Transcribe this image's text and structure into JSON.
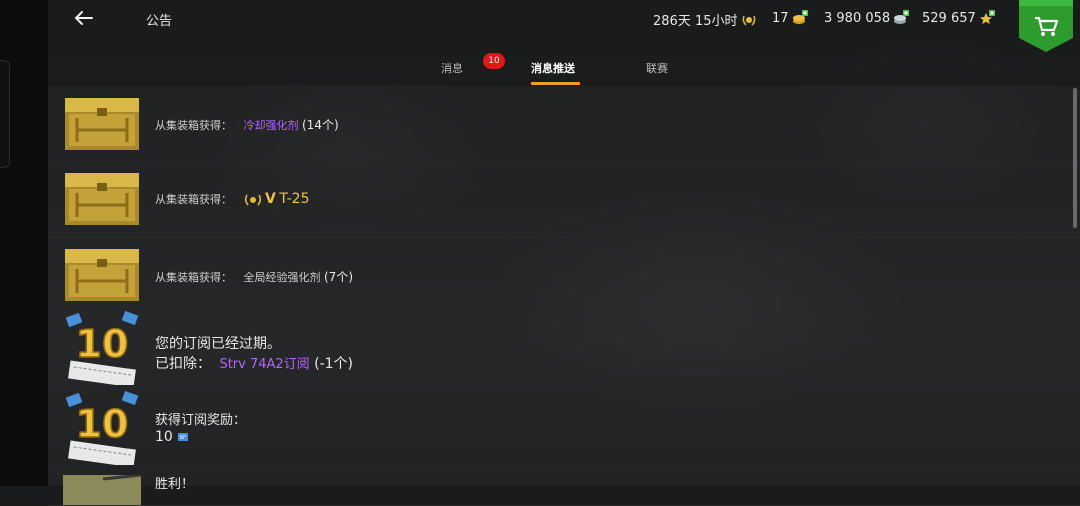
{
  "header": {
    "title": "公告",
    "premium_time": "286天 15小时",
    "gold": "17",
    "credits": "3 980 058",
    "free_xp": "529 657"
  },
  "tabs": [
    {
      "label": "消息",
      "badge": "10"
    },
    {
      "label": "消息推送",
      "active": true
    },
    {
      "label": "联赛"
    }
  ],
  "messages": [
    {
      "prefix": "从集装箱获得：",
      "item": "冷却强化剂",
      "qty": "(14个)",
      "icon": "gold-container-icon"
    },
    {
      "prefix": "从集装箱获得：",
      "tier": "V",
      "item": "T-25",
      "icon": "gold-container-icon"
    },
    {
      "prefix": "从集装箱获得：",
      "item": "全局经验强化剂",
      "qty": "(7个)",
      "icon": "gold-container-icon"
    },
    {
      "line1": "您的订阅已经过期。",
      "line2_prefix": "已扣除：",
      "item": "Strv 74A2订阅",
      "qty": "(-1个)",
      "icon": "subscription-10-icon"
    },
    {
      "line1": "获得订阅奖励：",
      "amount": "10",
      "icon": "subscription-10-icon"
    },
    {
      "line1": "胜利！",
      "icon": "tank-thumbnail-icon"
    }
  ],
  "colors": {
    "accent": "#f0a020",
    "purple": "#b565ff",
    "badge": "#e01818",
    "shop": "#2e9b2e"
  }
}
